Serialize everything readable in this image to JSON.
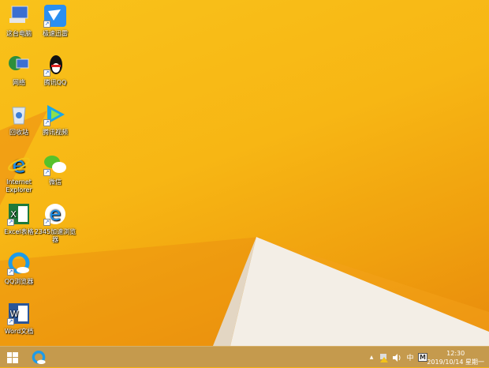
{
  "desktop": {
    "icons": [
      {
        "label": "这台电脑",
        "icon": "computer-icon"
      },
      {
        "label": "极速迅雷",
        "icon": "thunder-bird-icon"
      },
      {
        "label": "网络",
        "icon": "network-icon"
      },
      {
        "label": "腾讯QQ",
        "icon": "qq-penguin-icon"
      },
      {
        "label": "回收站",
        "icon": "recycle-bin-icon"
      },
      {
        "label": "腾讯视频",
        "icon": "tencent-video-icon"
      },
      {
        "label": "Internet Explorer",
        "icon": "ie-icon"
      },
      {
        "label": "微信",
        "icon": "wechat-icon"
      },
      {
        "label": "Excel表格",
        "icon": "excel-icon"
      },
      {
        "label": "2345加速浏览器",
        "icon": "browser-2345-icon"
      },
      {
        "label": "QQ浏览器",
        "icon": "qq-browser-icon"
      },
      {
        "label": "Word文档",
        "icon": "word-icon"
      }
    ]
  },
  "taskbar": {
    "tray": {
      "up_arrow": "▲",
      "ime": "中",
      "ime_mode": "M"
    },
    "clock": {
      "time": "12:30",
      "date": "2019/10/14 星期一"
    }
  },
  "colors": {
    "wallpaper": "#f7b614",
    "taskbar": "#c59a4d"
  }
}
